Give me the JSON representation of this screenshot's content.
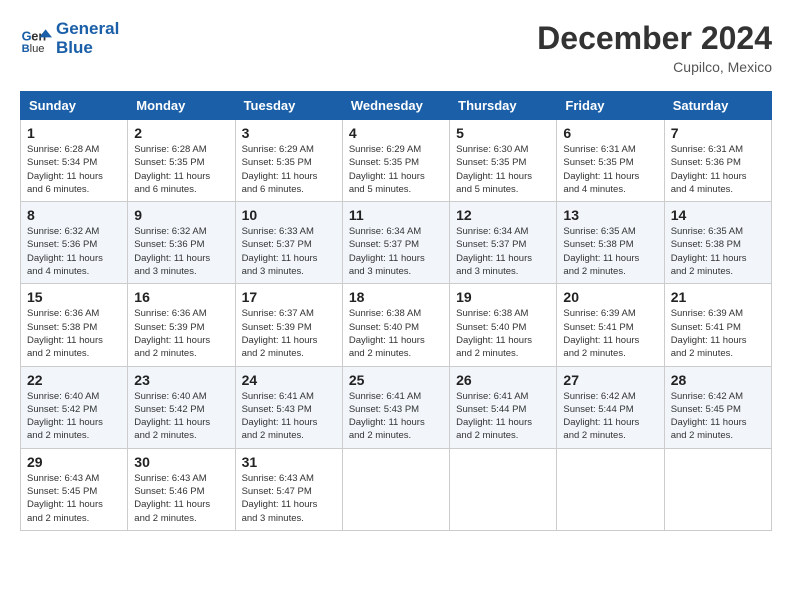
{
  "header": {
    "logo_line1": "General",
    "logo_line2": "Blue",
    "month_title": "December 2024",
    "location": "Cupilco, Mexico"
  },
  "days_of_week": [
    "Sunday",
    "Monday",
    "Tuesday",
    "Wednesday",
    "Thursday",
    "Friday",
    "Saturday"
  ],
  "weeks": [
    [
      {
        "day": "1",
        "info": "Sunrise: 6:28 AM\nSunset: 5:34 PM\nDaylight: 11 hours and 6 minutes."
      },
      {
        "day": "2",
        "info": "Sunrise: 6:28 AM\nSunset: 5:35 PM\nDaylight: 11 hours and 6 minutes."
      },
      {
        "day": "3",
        "info": "Sunrise: 6:29 AM\nSunset: 5:35 PM\nDaylight: 11 hours and 6 minutes."
      },
      {
        "day": "4",
        "info": "Sunrise: 6:29 AM\nSunset: 5:35 PM\nDaylight: 11 hours and 5 minutes."
      },
      {
        "day": "5",
        "info": "Sunrise: 6:30 AM\nSunset: 5:35 PM\nDaylight: 11 hours and 5 minutes."
      },
      {
        "day": "6",
        "info": "Sunrise: 6:31 AM\nSunset: 5:35 PM\nDaylight: 11 hours and 4 minutes."
      },
      {
        "day": "7",
        "info": "Sunrise: 6:31 AM\nSunset: 5:36 PM\nDaylight: 11 hours and 4 minutes."
      }
    ],
    [
      {
        "day": "8",
        "info": "Sunrise: 6:32 AM\nSunset: 5:36 PM\nDaylight: 11 hours and 4 minutes."
      },
      {
        "day": "9",
        "info": "Sunrise: 6:32 AM\nSunset: 5:36 PM\nDaylight: 11 hours and 3 minutes."
      },
      {
        "day": "10",
        "info": "Sunrise: 6:33 AM\nSunset: 5:37 PM\nDaylight: 11 hours and 3 minutes."
      },
      {
        "day": "11",
        "info": "Sunrise: 6:34 AM\nSunset: 5:37 PM\nDaylight: 11 hours and 3 minutes."
      },
      {
        "day": "12",
        "info": "Sunrise: 6:34 AM\nSunset: 5:37 PM\nDaylight: 11 hours and 3 minutes."
      },
      {
        "day": "13",
        "info": "Sunrise: 6:35 AM\nSunset: 5:38 PM\nDaylight: 11 hours and 2 minutes."
      },
      {
        "day": "14",
        "info": "Sunrise: 6:35 AM\nSunset: 5:38 PM\nDaylight: 11 hours and 2 minutes."
      }
    ],
    [
      {
        "day": "15",
        "info": "Sunrise: 6:36 AM\nSunset: 5:38 PM\nDaylight: 11 hours and 2 minutes."
      },
      {
        "day": "16",
        "info": "Sunrise: 6:36 AM\nSunset: 5:39 PM\nDaylight: 11 hours and 2 minutes."
      },
      {
        "day": "17",
        "info": "Sunrise: 6:37 AM\nSunset: 5:39 PM\nDaylight: 11 hours and 2 minutes."
      },
      {
        "day": "18",
        "info": "Sunrise: 6:38 AM\nSunset: 5:40 PM\nDaylight: 11 hours and 2 minutes."
      },
      {
        "day": "19",
        "info": "Sunrise: 6:38 AM\nSunset: 5:40 PM\nDaylight: 11 hours and 2 minutes."
      },
      {
        "day": "20",
        "info": "Sunrise: 6:39 AM\nSunset: 5:41 PM\nDaylight: 11 hours and 2 minutes."
      },
      {
        "day": "21",
        "info": "Sunrise: 6:39 AM\nSunset: 5:41 PM\nDaylight: 11 hours and 2 minutes."
      }
    ],
    [
      {
        "day": "22",
        "info": "Sunrise: 6:40 AM\nSunset: 5:42 PM\nDaylight: 11 hours and 2 minutes."
      },
      {
        "day": "23",
        "info": "Sunrise: 6:40 AM\nSunset: 5:42 PM\nDaylight: 11 hours and 2 minutes."
      },
      {
        "day": "24",
        "info": "Sunrise: 6:41 AM\nSunset: 5:43 PM\nDaylight: 11 hours and 2 minutes."
      },
      {
        "day": "25",
        "info": "Sunrise: 6:41 AM\nSunset: 5:43 PM\nDaylight: 11 hours and 2 minutes."
      },
      {
        "day": "26",
        "info": "Sunrise: 6:41 AM\nSunset: 5:44 PM\nDaylight: 11 hours and 2 minutes."
      },
      {
        "day": "27",
        "info": "Sunrise: 6:42 AM\nSunset: 5:44 PM\nDaylight: 11 hours and 2 minutes."
      },
      {
        "day": "28",
        "info": "Sunrise: 6:42 AM\nSunset: 5:45 PM\nDaylight: 11 hours and 2 minutes."
      }
    ],
    [
      {
        "day": "29",
        "info": "Sunrise: 6:43 AM\nSunset: 5:45 PM\nDaylight: 11 hours and 2 minutes."
      },
      {
        "day": "30",
        "info": "Sunrise: 6:43 AM\nSunset: 5:46 PM\nDaylight: 11 hours and 2 minutes."
      },
      {
        "day": "31",
        "info": "Sunrise: 6:43 AM\nSunset: 5:47 PM\nDaylight: 11 hours and 3 minutes."
      },
      null,
      null,
      null,
      null
    ]
  ]
}
